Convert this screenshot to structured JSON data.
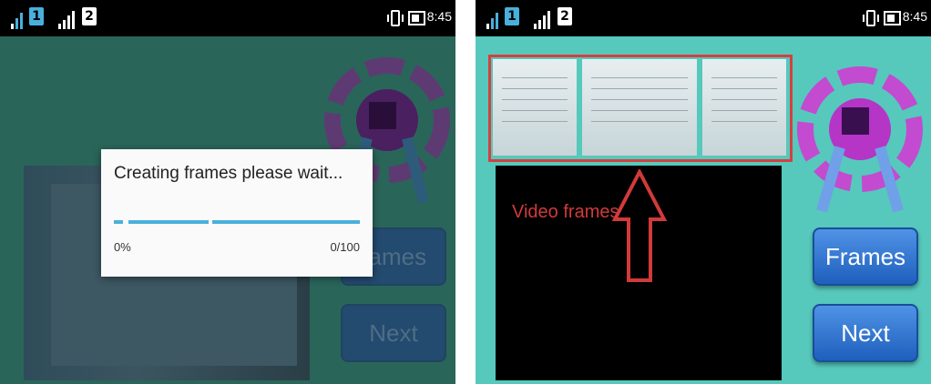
{
  "status_bar": {
    "sim1": "1",
    "sim2": "2",
    "time": "8:45"
  },
  "left_screen": {
    "dialog": {
      "message": "Creating frames please wait...",
      "percent": "0%",
      "count": "0/100",
      "progress": 0
    },
    "buttons": {
      "frames": "rames",
      "next": "Next"
    }
  },
  "right_screen": {
    "annotation": "Video frames",
    "buttons": {
      "frames": "Frames",
      "next": "Next"
    }
  },
  "colors": {
    "left_background": "#2a655a",
    "right_background": "#56c8bc",
    "button_blue": "#3b7fd9",
    "annotation_red": "#d23a3a",
    "progress_blue": "#49b0dc",
    "logo_magenta": "#c24bd0"
  },
  "icons": [
    "signal-icon",
    "vibrate-icon",
    "battery-icon",
    "app-logo-icon",
    "up-arrow-icon"
  ]
}
